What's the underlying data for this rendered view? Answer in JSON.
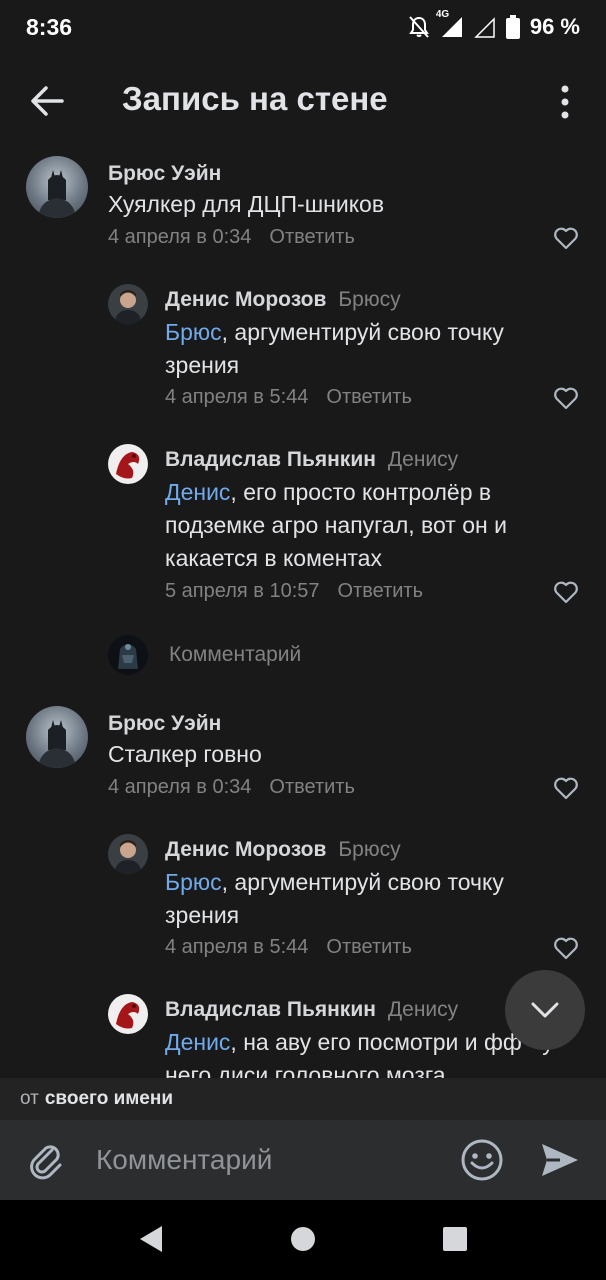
{
  "status_bar": {
    "time": "8:36",
    "network": "4G",
    "battery": "96 %"
  },
  "header": {
    "title": "Запись на стене"
  },
  "comments": [
    {
      "author": "Брюс Уэйн",
      "reply_to": "",
      "mention": "",
      "text": "Хуялкер для ДЦП-шников",
      "date": "4 апреля в 0:34",
      "reply_label": "Ответить"
    },
    {
      "author": "Денис Морозов",
      "reply_to": "Брюсу",
      "mention": "Брюс",
      "text": ", аргументируй свою точку зрения",
      "date": "4 апреля в 5:44",
      "reply_label": "Ответить"
    },
    {
      "author": "Владислав Пьянкин",
      "reply_to": "Денису",
      "mention": "Денис",
      "text": ", его просто контролёр в подземке агро напугал, вот он и какается в коментах",
      "date": "5 апреля в 10:57",
      "reply_label": "Ответить"
    },
    {
      "author": "Брюс Уэйн",
      "reply_to": "",
      "mention": "",
      "text": "Сталкер говно",
      "date": "4 апреля в 0:34",
      "reply_label": "Ответить"
    },
    {
      "author": "Денис Морозов",
      "reply_to": "Брюсу",
      "mention": "Брюс",
      "text": ", аргументируй свою точку зрения",
      "date": "4 апреля в 5:44",
      "reply_label": "Ответить"
    },
    {
      "author": "Владислав Пьянкин",
      "reply_to": "Денису",
      "mention": "Денис",
      "text": ", на аву его посмотри и фф - у него диси головного мозга",
      "date": "",
      "reply_label": ""
    }
  ],
  "thread_reply_placeholder": "Комментарий",
  "from_bar": {
    "prefix": "от",
    "name": "своего имени"
  },
  "input_bar": {
    "placeholder": "Комментарий"
  },
  "colors": {
    "background": "#19191a",
    "mention": "#71aaeb",
    "secondary_text": "#828282",
    "input_bar": "#2c2d2e"
  },
  "icons": [
    "back-arrow-icon",
    "more-vertical-icon",
    "heart-icon",
    "chevron-down-icon",
    "paperclip-icon",
    "smile-icon",
    "send-icon",
    "nav-back-icon",
    "nav-home-icon",
    "nav-recents-icon"
  ]
}
